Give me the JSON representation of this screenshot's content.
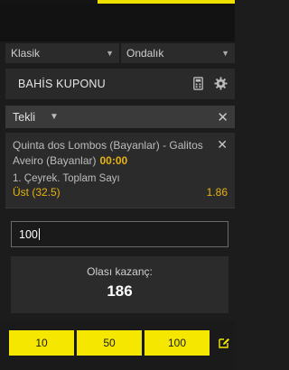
{
  "colors": {
    "accent_yellow": "#f5e700",
    "highlight_orange": "#e8b30e",
    "panel": "#2b2b2b",
    "background": "#1c1c1c"
  },
  "selects": {
    "mode": {
      "value": "Klasik",
      "icon": "chevron-down-icon"
    },
    "odds_format": {
      "value": "Ondalık",
      "icon": "chevron-down-icon"
    }
  },
  "coupon": {
    "title": "BAHİS KUPONU",
    "calculator_icon": "calculator-icon",
    "settings_icon": "gear-icon"
  },
  "bet_type": {
    "value": "Tekli",
    "close_icon": "close-icon"
  },
  "bet": {
    "match": "Quinta dos Lombos (Bayanlar) - Galitos Aveiro (Bayanlar)",
    "time": "00:00",
    "market": "1. Çeyrek. Toplam Sayı",
    "selection": "Üst (32.5)",
    "odds": "1.86"
  },
  "stake": {
    "value": "100"
  },
  "potential_win": {
    "label": "Olası kazanç:",
    "value": "186"
  },
  "quick_stakes": [
    "10",
    "50",
    "100"
  ],
  "edit_icon": "edit-icon"
}
